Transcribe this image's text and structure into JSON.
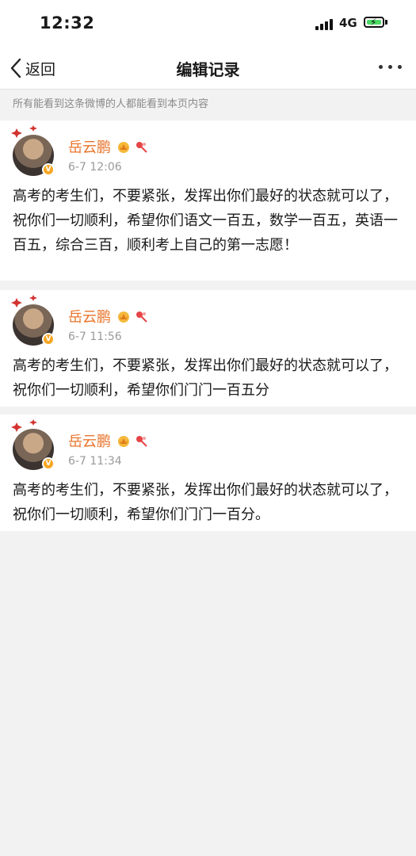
{
  "status_bar": {
    "time": "12:32",
    "network": "4G"
  },
  "nav": {
    "back_label": "返回",
    "title": "编辑记录"
  },
  "notice": "所有能看到这条微博的人都能看到本页内容",
  "posts": [
    {
      "author": "岳云鹏",
      "timestamp": "6-7 12:06",
      "text": "高考的考生们，不要紧张，发挥出你们最好的状态就可以了，祝你们一切顺利，希望你们语文一百五，数学一百五，英语一百五，综合三百，顺利考上自己的第一志愿！"
    },
    {
      "author": "岳云鹏",
      "timestamp": "6-7 11:56",
      "text": "高考的考生们，不要紧张，发挥出你们最好的状态就可以了，祝你们一切顺利，希望你们门门一百五分"
    },
    {
      "author": "岳云鹏",
      "timestamp": "6-7 11:34",
      "text": "高考的考生们，不要紧张，发挥出你们最好的状态就可以了，祝你们一切顺利，希望你们门门一百分。"
    }
  ],
  "icons": [
    "back-chevron-icon",
    "more-icon",
    "signal-icon",
    "battery-icon",
    "crown-icon",
    "flower-icon",
    "verified-badge-icon"
  ],
  "colors": {
    "name": "#e9742b",
    "timestamp": "#9a9a9a",
    "background": "#f2f2f2",
    "battery_fill": "#4cd964",
    "badge": "#f6a623"
  }
}
